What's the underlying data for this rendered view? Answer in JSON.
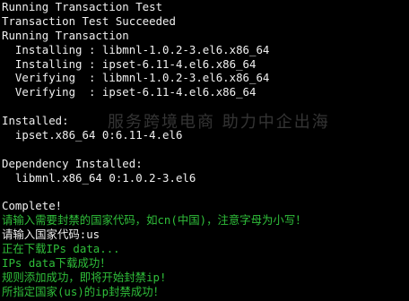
{
  "terminal": {
    "lines": [
      {
        "text": "Running Transaction Test",
        "color": "#f0f0f0"
      },
      {
        "text": "Transaction Test Succeeded",
        "color": "#f0f0f0"
      },
      {
        "text": "Running Transaction",
        "color": "#f0f0f0"
      },
      {
        "text": "  Installing : libmnl-1.0.2-3.el6.x86_64",
        "color": "#f0f0f0"
      },
      {
        "text": "  Installing : ipset-6.11-4.el6.x86_64",
        "color": "#f0f0f0"
      },
      {
        "text": "  Verifying  : libmnl-1.0.2-3.el6.x86_64",
        "color": "#f0f0f0"
      },
      {
        "text": "  Verifying  : ipset-6.11-4.el6.x86_64",
        "color": "#f0f0f0"
      },
      {
        "text": "",
        "color": "#f0f0f0"
      },
      {
        "text": "Installed:",
        "color": "#f0f0f0"
      },
      {
        "text": "  ipset.x86_64 0:6.11-4.el6",
        "color": "#f0f0f0"
      },
      {
        "text": "",
        "color": "#f0f0f0"
      },
      {
        "text": "Dependency Installed:",
        "color": "#f0f0f0"
      },
      {
        "text": "  libmnl.x86_64 0:1.0.2-3.el6",
        "color": "#f0f0f0"
      },
      {
        "text": "",
        "color": "#f0f0f0"
      },
      {
        "text": "Complete!",
        "color": "#f0f0f0"
      },
      {
        "text": "请输入需要封禁的国家代码，如cn(中国)，注意字母为小写！",
        "color": "#2fbf3a"
      },
      {
        "text": "请输入国家代码:us",
        "color": "#f0f0f0"
      },
      {
        "text": "正在下载IPs data...",
        "color": "#2fbf3a"
      },
      {
        "text": "IPs data下载成功！",
        "color": "#2fbf3a"
      },
      {
        "text": "规则添加成功，即将开始封禁ip!",
        "color": "#2fbf3a"
      },
      {
        "text": "所指定国家(us)的ip封禁成功！",
        "color": "#2fbf3a"
      }
    ]
  },
  "watermark": {
    "tagline": "服务跨境电商 助力中企出海"
  }
}
